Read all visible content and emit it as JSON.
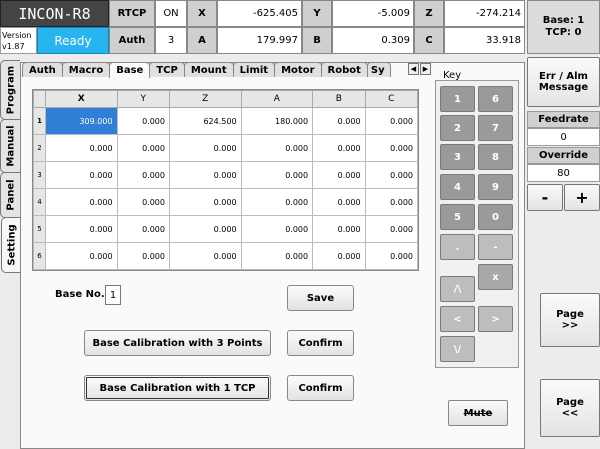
{
  "header": {
    "app_name": "INCON-R8",
    "version_label": "Version",
    "version": "v1.87",
    "status": "Ready",
    "rtcp_label": "RTCP",
    "rtcp_value": "ON",
    "auth_label": "Auth",
    "auth_value": "3",
    "coords": {
      "x_label": "X",
      "x": "-625.405",
      "y_label": "Y",
      "y": "-5.009",
      "z_label": "Z",
      "z": "-274.214",
      "a_label": "A",
      "a": "179.997",
      "b_label": "B",
      "b": "0.309",
      "c_label": "C",
      "c": "33.918"
    }
  },
  "right_panel": {
    "base_line": "Base: 1",
    "tcp_line": "TCP: 0",
    "err_alm_line1": "Err / Alm",
    "err_alm_line2": "Message",
    "feedrate_label": "Feedrate",
    "feedrate_value": "0",
    "override_label": "Override",
    "override_value": "80",
    "minus_label": "-",
    "plus_label": "+",
    "page_next_line1": "Page",
    "page_next_line2": ">>",
    "page_prev_line1": "Page",
    "page_prev_line2": "<<"
  },
  "side_tabs": [
    "Program",
    "Manual",
    "Panel",
    "Setting"
  ],
  "tabs": [
    "Auth",
    "Macro",
    "Base",
    "TCP",
    "Mount",
    "Limit",
    "Motor",
    "Robot",
    "Sy"
  ],
  "active_tab": "Base",
  "table": {
    "columns": [
      "X",
      "Y",
      "Z",
      "A",
      "B",
      "C"
    ],
    "rows": [
      {
        "n": "1",
        "cells": [
          "309.000",
          "0.000",
          "624.500",
          "180.000",
          "0.000",
          "0.000"
        ]
      },
      {
        "n": "2",
        "cells": [
          "0.000",
          "0.000",
          "0.000",
          "0.000",
          "0.000",
          "0.000"
        ]
      },
      {
        "n": "3",
        "cells": [
          "0.000",
          "0.000",
          "0.000",
          "0.000",
          "0.000",
          "0.000"
        ]
      },
      {
        "n": "4",
        "cells": [
          "0.000",
          "0.000",
          "0.000",
          "0.000",
          "0.000",
          "0.000"
        ]
      },
      {
        "n": "5",
        "cells": [
          "0.000",
          "0.000",
          "0.000",
          "0.000",
          "0.000",
          "0.000"
        ]
      },
      {
        "n": "6",
        "cells": [
          "0.000",
          "0.000",
          "0.000",
          "0.000",
          "0.000",
          "0.000"
        ]
      }
    ]
  },
  "base_panel": {
    "base_no_label": "Base No.",
    "base_no_value": "1",
    "save_label": "Save",
    "calib3_label": "Base Calibration with 3 Points",
    "calib_tcp_label": "Base Calibration with 1 TCP",
    "confirm_label": "Confirm"
  },
  "keypad": {
    "title": "Key",
    "keys": [
      "1",
      "6",
      "2",
      "7",
      "3",
      "8",
      "4",
      "9",
      "5",
      "0",
      ".",
      "-",
      "x",
      "/\\",
      "<",
      ">",
      "\\/"
    ],
    "mute_label": "Mute"
  },
  "colors": {
    "ready": "#27b4f0",
    "selected_cell": "#2f7fd6",
    "key": "#9a9a9a"
  }
}
